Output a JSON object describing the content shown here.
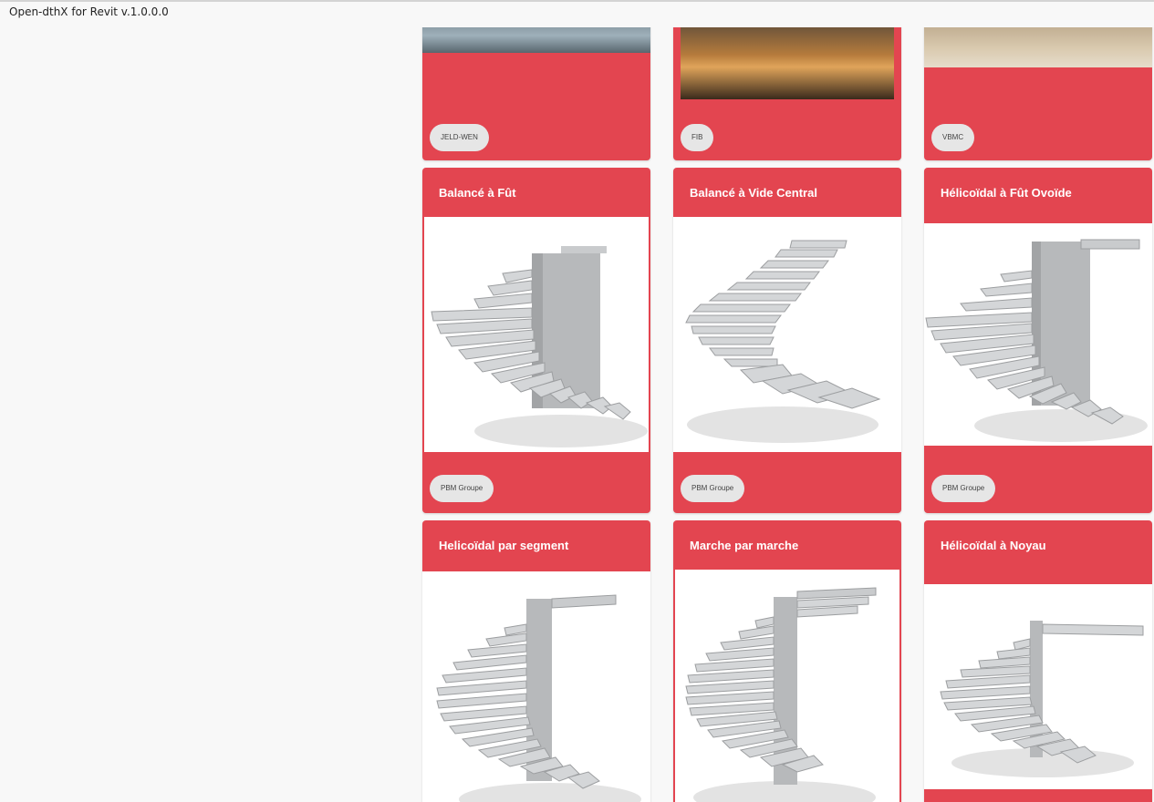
{
  "window": {
    "title": "Open-dthX for Revit v.1.0.0.0"
  },
  "colors": {
    "card_red": "#e34550",
    "chip_bg": "#e6e6e6",
    "page_bg": "#f8f8f8"
  },
  "top_row": [
    {
      "chip": "JELD-WEN"
    },
    {
      "chip": "FIB"
    },
    {
      "chip": "VBMC"
    }
  ],
  "mid_row": [
    {
      "title": "Balancé à Fût",
      "chip": "PBM Groupe"
    },
    {
      "title": "Balancé à Vide Central",
      "chip": "PBM Groupe"
    },
    {
      "title": "Hélicoïdal à Fût Ovoïde",
      "chip": "PBM Groupe"
    }
  ],
  "bottom_row": [
    {
      "title": "Helicoïdal par segment"
    },
    {
      "title": "Marche par marche"
    },
    {
      "title": "Hélicoïdal à Noyau"
    }
  ]
}
